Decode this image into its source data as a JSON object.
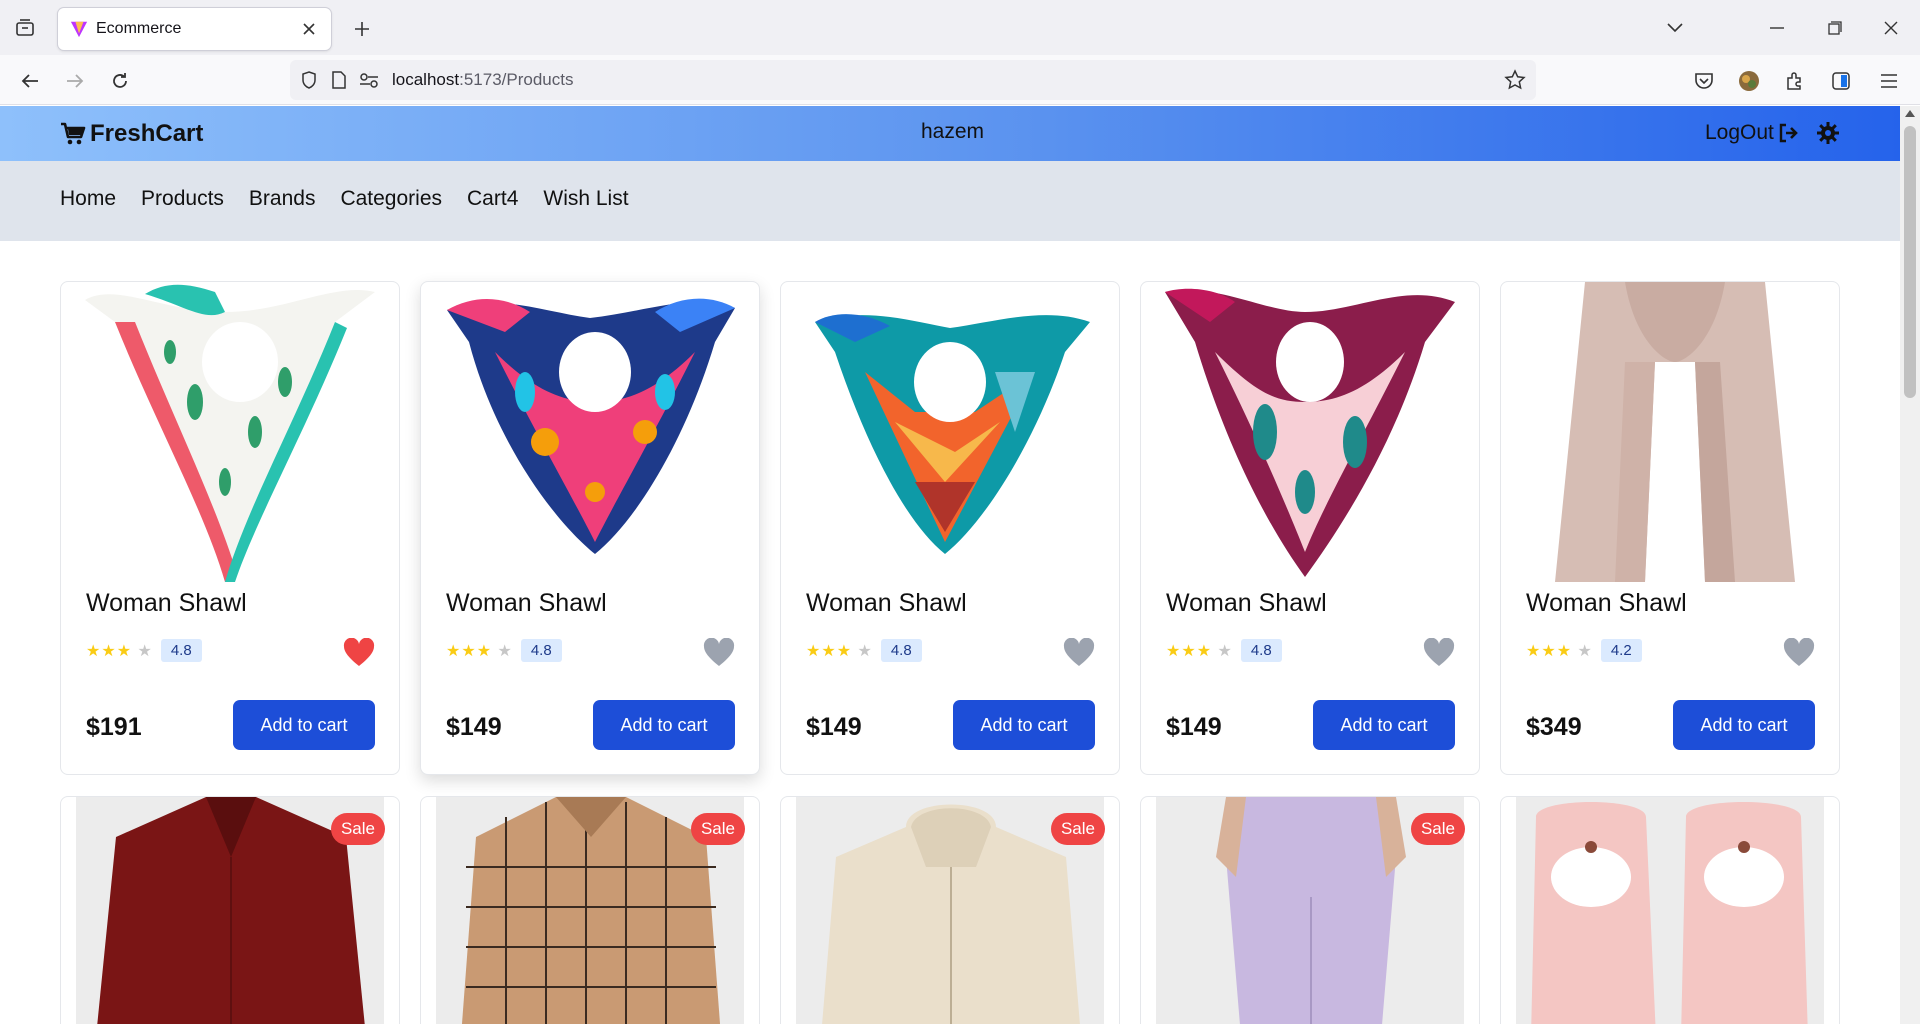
{
  "browser": {
    "tab_title": "Ecommerce",
    "url_host": "localhost",
    "url_path": ":5173/Products"
  },
  "header": {
    "brand": "FreshCart",
    "username": "hazem",
    "logout_label": "LogOut"
  },
  "nav": {
    "items": [
      "Home",
      "Products",
      "Brands",
      "Categories",
      "Cart4",
      "Wish List"
    ]
  },
  "products": [
    {
      "name": "Woman Shawl",
      "rating": "4.8",
      "price": "$191",
      "cta": "Add to cart",
      "wishlisted": true
    },
    {
      "name": "Woman Shawl",
      "rating": "4.8",
      "price": "$149",
      "cta": "Add to cart",
      "wishlisted": false
    },
    {
      "name": "Woman Shawl",
      "rating": "4.8",
      "price": "$149",
      "cta": "Add to cart",
      "wishlisted": false
    },
    {
      "name": "Woman Shawl",
      "rating": "4.8",
      "price": "$149",
      "cta": "Add to cart",
      "wishlisted": false
    },
    {
      "name": "Woman Shawl",
      "rating": "4.2",
      "price": "$349",
      "cta": "Add to cart",
      "wishlisted": false
    }
  ],
  "second_row": [
    {
      "badge": "Sale"
    },
    {
      "badge": "Sale"
    },
    {
      "badge": "Sale"
    },
    {
      "badge": "Sale"
    },
    {
      "badge": ""
    }
  ],
  "colors": {
    "accent": "#1d4ed8",
    "heart_active": "#ef4444",
    "heart_inactive": "#9ca3af",
    "sale": "#ef4444"
  }
}
